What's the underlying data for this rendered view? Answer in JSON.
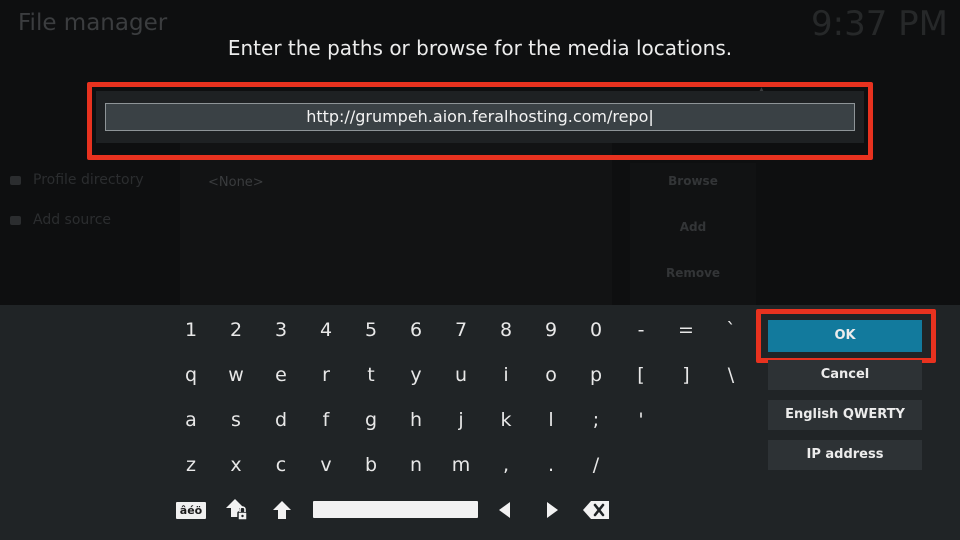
{
  "app": {
    "title": "File manager",
    "clock": "9:37 PM"
  },
  "background": {
    "sidebar": [
      {
        "label": "Profile directory"
      },
      {
        "label": "Add source"
      }
    ],
    "paths_list": {
      "empty_label": "<None>"
    },
    "buttons": {
      "browse": "Browse",
      "add": "Add",
      "remove": "Remove"
    }
  },
  "dialog": {
    "heading": "Enter the paths or browse for the media locations.",
    "input": {
      "value": "http://grumpeh.aion.feralhosting.com/repo",
      "caret": "|"
    }
  },
  "keyboard": {
    "rows": [
      [
        "1",
        "2",
        "3",
        "4",
        "5",
        "6",
        "7",
        "8",
        "9",
        "0",
        "-",
        "=",
        "`"
      ],
      [
        "q",
        "w",
        "e",
        "r",
        "t",
        "y",
        "u",
        "i",
        "o",
        "p",
        "[",
        "]",
        "\\"
      ],
      [
        "a",
        "s",
        "d",
        "f",
        "g",
        "h",
        "j",
        "k",
        "l",
        ";",
        "'"
      ],
      [
        "z",
        "x",
        "c",
        "v",
        "b",
        "n",
        "m",
        ",",
        ".",
        "/"
      ]
    ],
    "bottom": {
      "accent_label": "âéö",
      "icons": [
        "caps-lock-icon",
        "shift-icon",
        "space-bar",
        "left-arrow-icon",
        "right-arrow-icon",
        "backspace-icon"
      ]
    },
    "side_buttons": {
      "ok": "OK",
      "cancel": "Cancel",
      "layout": "English QWERTY",
      "ip": "IP address"
    }
  },
  "colors": {
    "accent": "#127a9d",
    "highlight": "#e8321f",
    "panel": "#202426"
  }
}
